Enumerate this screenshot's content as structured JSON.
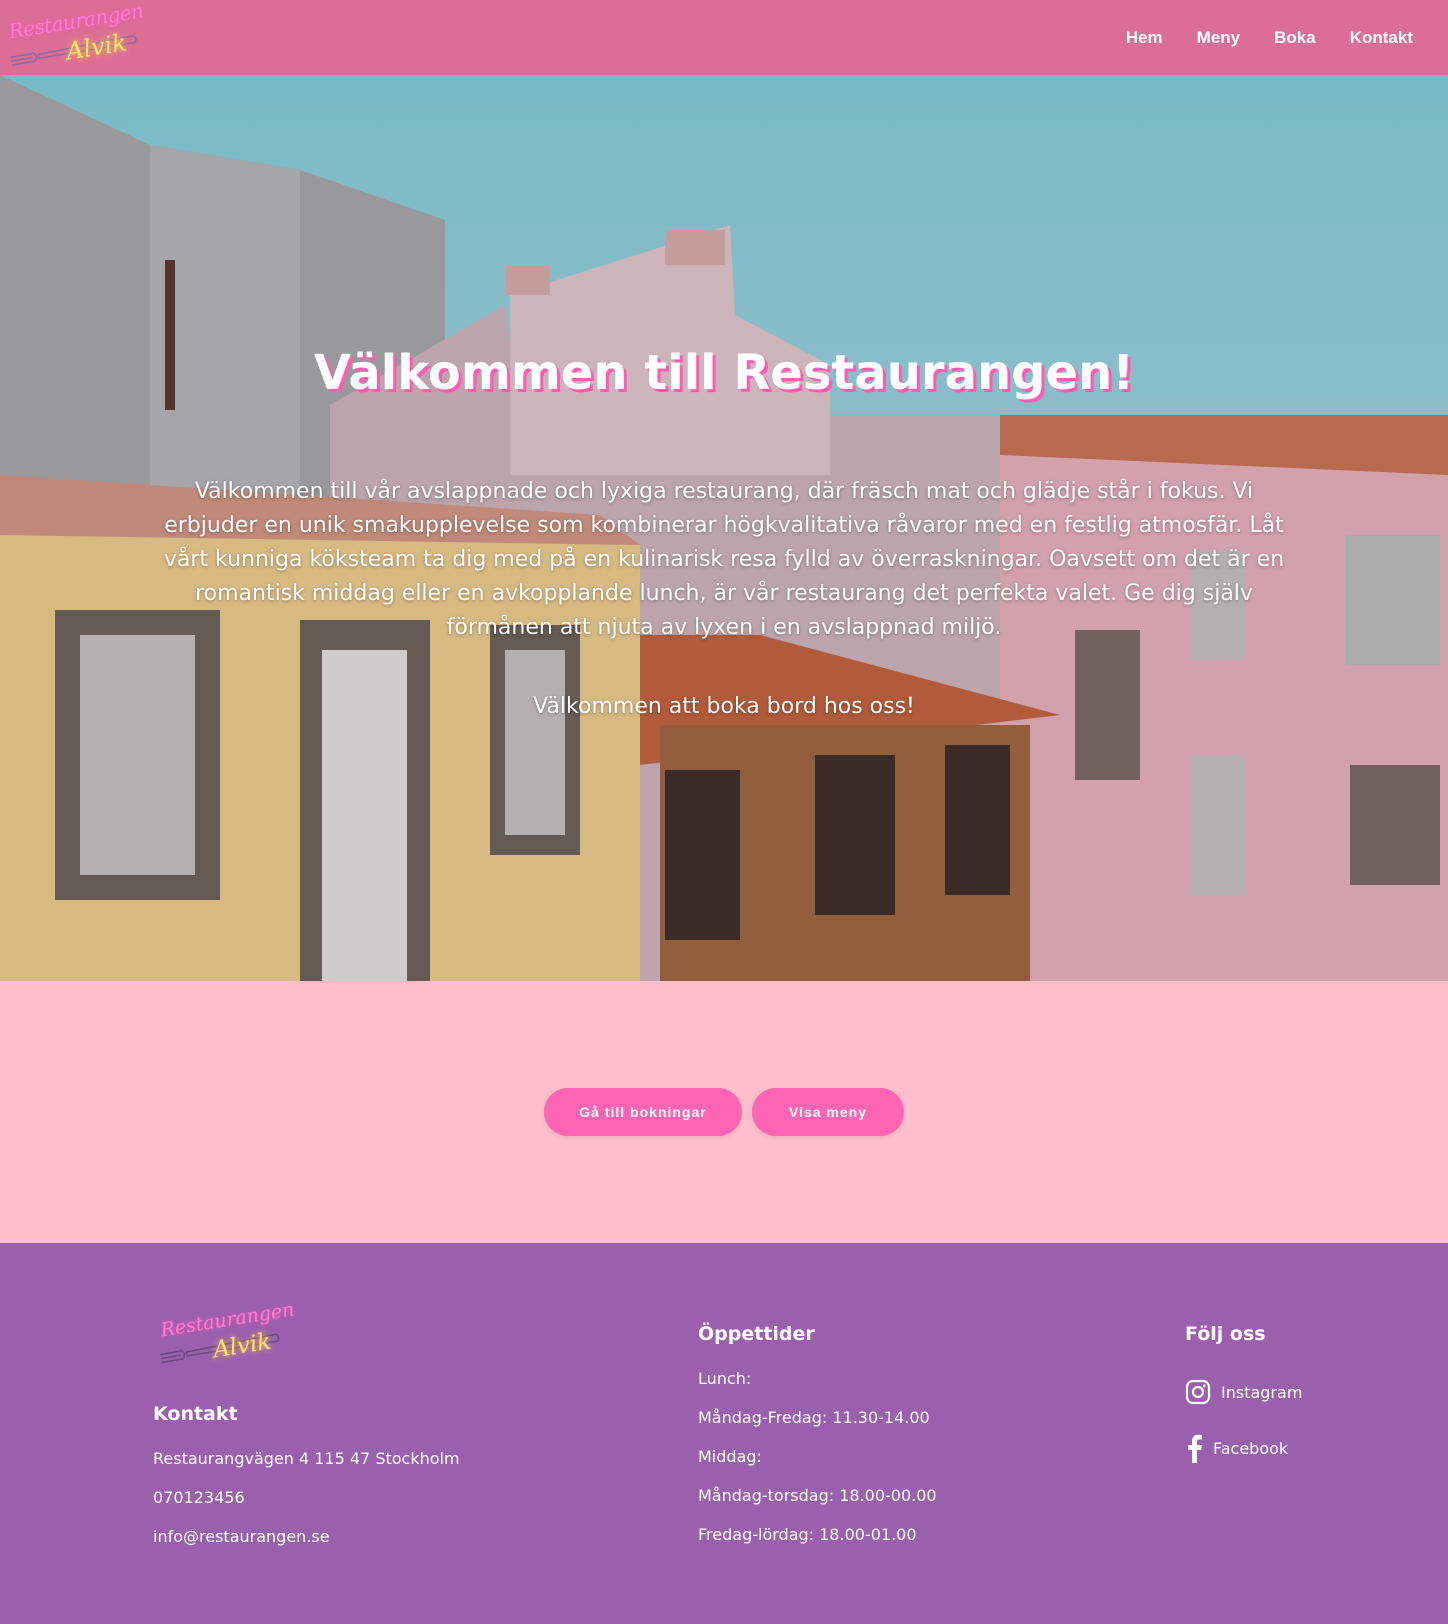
{
  "header": {
    "logo_line1": "Restaurangen",
    "logo_line2": "Alvik",
    "nav": [
      "Hem",
      "Meny",
      "Boka",
      "Kontakt"
    ]
  },
  "hero": {
    "title": "Välkommen till Restaurangen!",
    "text": "Välkommen till vår avslappnade och lyxiga restaurang, där fräsch mat och glädje står i fokus. Vi erbjuder en unik smakupplevelse som kombinerar högkvalitativa råvaror med en festlig atmosfär. Låt vårt kunniga köksteam ta dig med på en kulinarisk resa fylld av överraskningar. Oavsett om det är en romantisk middag eller en avkopplande lunch, är vår restaurang det perfekta valet. Ge dig själv förmånen att njuta av lyxen i en avslappnad miljö.",
    "subtext": "Välkommen att boka bord hos oss!"
  },
  "buttons": {
    "bookings": "Gå till bokningar",
    "menu": "Visa meny"
  },
  "footer": {
    "logo_line1": "Restaurangen",
    "logo_line2": "Alvik",
    "contact": {
      "heading": "Kontakt",
      "address": "Restaurangvägen 4 115 47 Stockholm",
      "phone": "070123456",
      "email": "info@restaurangen.se"
    },
    "hours": {
      "heading": "Öppettider",
      "lunch_label": "Lunch:",
      "lunch_hours": "Måndag-Fredag: 11.30-14.00",
      "dinner_label": "Middag:",
      "dinner_hours_1": "Måndag-torsdag: 18.00-00.00",
      "dinner_hours_2": "Fredag-lördag: 18.00-01.00"
    },
    "social": {
      "heading": "Följ oss",
      "instagram": "Instagram",
      "facebook": "Facebook"
    }
  },
  "colors": {
    "header_bg": "#dc6e96",
    "page_bg": "#ffbecb",
    "button_bg": "#ff64b4",
    "footer_bg": "#9a60ad"
  }
}
